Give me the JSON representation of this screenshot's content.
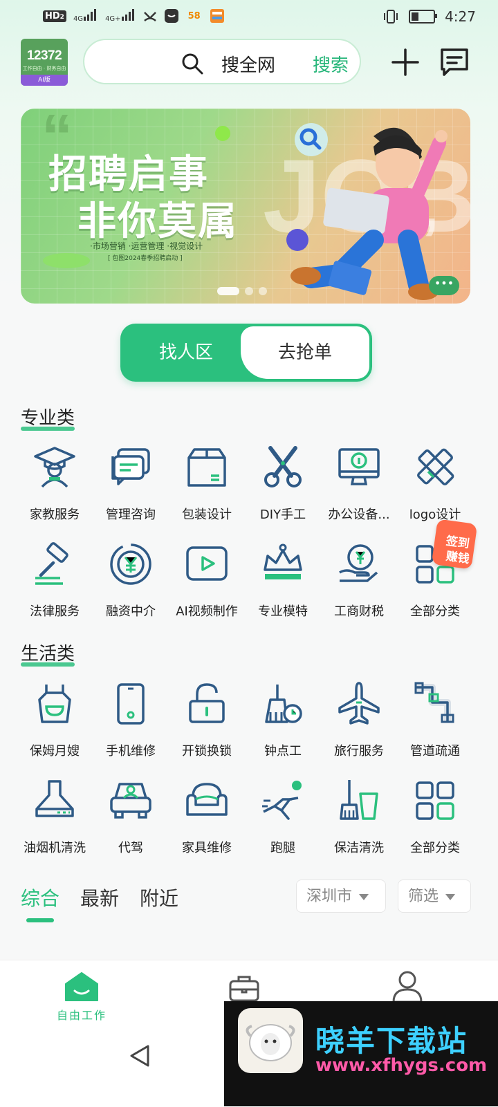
{
  "status_bar": {
    "hd": "HD",
    "hd_sub": "2",
    "net1": "4G",
    "net2": "4G+",
    "app58": "58",
    "time": "4:27",
    "battery_level": 0.35
  },
  "header": {
    "logo_number": "12372",
    "logo_sub": "工作自由 · 财务自由",
    "logo_tag": "AI版",
    "search_placeholder": "搜全网",
    "search_button": "搜索",
    "add_icon": "plus-icon",
    "message_icon": "message-icon"
  },
  "banner": {
    "title_line1": "招聘启事",
    "title_line2": "非你莫属",
    "tags": "·市场营销   ·运营管理   ·视觉设计",
    "note": "[ 包图2024春季招聘启动 ]",
    "deco_text": "JOB",
    "dots": 3,
    "active_dot": 0,
    "more": "•••"
  },
  "toggle": {
    "active": "找人区",
    "inactive": "去抢单"
  },
  "professional": {
    "title": "专业类",
    "items": [
      {
        "label": "家教服务",
        "icon": "graduate-icon"
      },
      {
        "label": "管理咨询",
        "icon": "chat-icon"
      },
      {
        "label": "包装设计",
        "icon": "box-icon"
      },
      {
        "label": "DIY手工",
        "icon": "scissors-icon"
      },
      {
        "label": "办公设备...",
        "icon": "monitor-icon"
      },
      {
        "label": "logo设计",
        "icon": "pencil-ruler-icon"
      },
      {
        "label": "法律服务",
        "icon": "gavel-icon"
      },
      {
        "label": "融资中介",
        "icon": "yuan-coin-icon"
      },
      {
        "label": "AI视频制作",
        "icon": "play-icon"
      },
      {
        "label": "专业模特",
        "icon": "crown-icon"
      },
      {
        "label": "工商财税",
        "icon": "money-hand-icon"
      },
      {
        "label": "全部分类",
        "icon": "grid-icon"
      }
    ]
  },
  "life": {
    "title": "生活类",
    "items": [
      {
        "label": "保姆月嫂",
        "icon": "apron-icon"
      },
      {
        "label": "手机维修",
        "icon": "phone-icon"
      },
      {
        "label": "开锁换锁",
        "icon": "unlock-icon"
      },
      {
        "label": "钟点工",
        "icon": "broom-clock-icon"
      },
      {
        "label": "旅行服务",
        "icon": "plane-icon"
      },
      {
        "label": "管道疏通",
        "icon": "pipe-icon"
      },
      {
        "label": "油烟机清洗",
        "icon": "range-hood-icon"
      },
      {
        "label": "代驾",
        "icon": "car-driver-icon"
      },
      {
        "label": "家具维修",
        "icon": "sofa-icon"
      },
      {
        "label": "跑腿",
        "icon": "runner-icon"
      },
      {
        "label": "保洁清洗",
        "icon": "mop-bucket-icon"
      },
      {
        "label": "全部分类",
        "icon": "grid-icon"
      }
    ]
  },
  "floating": {
    "line1": "签到",
    "line2": "赚钱"
  },
  "feed_tabs": [
    {
      "label": "综合",
      "active": true
    },
    {
      "label": "最新",
      "active": false
    },
    {
      "label": "附近",
      "active": false
    }
  ],
  "filters": {
    "city": "深圳市",
    "filter": "筛选"
  },
  "bottom_nav": {
    "home_label": "自由工作",
    "accent": "#2bc07e"
  },
  "watermark": {
    "name": "晓羊下载站",
    "url": "www.xfhygs.com"
  }
}
